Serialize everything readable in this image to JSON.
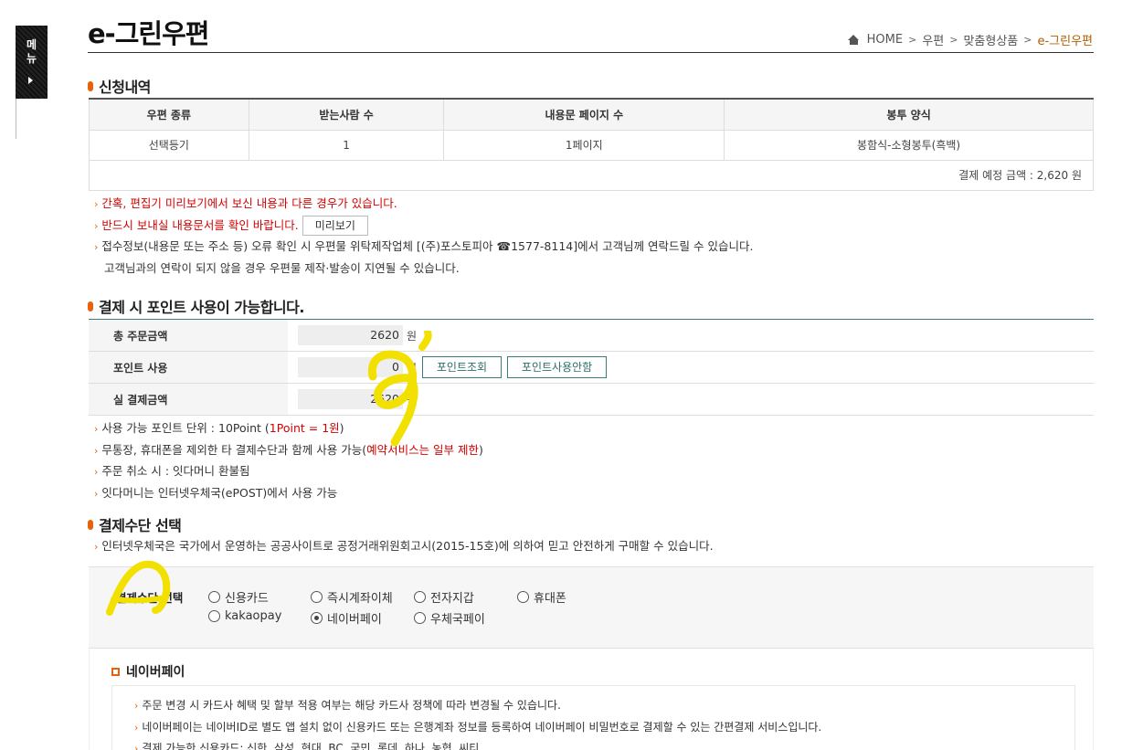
{
  "side_menu": {
    "label_line1": "메",
    "label_line2": "뉴"
  },
  "page": {
    "title": "e-그린우편"
  },
  "breadcrumb": {
    "home": "HOME",
    "level1": "우편",
    "level2": "맞춤형상품",
    "current": "e-그린우편"
  },
  "apply": {
    "heading": "신청내역",
    "headers": [
      "우편 종류",
      "받는사람 수",
      "내용문 페이지 수",
      "봉투 양식"
    ],
    "row": [
      "선택등기",
      "1",
      "1페이지",
      "봉함식-소형봉투(흑백)"
    ],
    "total_label": "결제 예정 금액 : 2,620 원"
  },
  "notes1": {
    "line1": "간혹, 편집기 미리보기에서 보신 내용과 다른 경우가 있습니다.",
    "line2": "반드시 보내실 내용문서를 확인 바랍니다.",
    "preview_button": "미리보기",
    "line3": "접수정보(내용문 또는 주소 등) 오류 확인 시 우편물 위탁제작업체 [(주)포스토피아 ☎1577-8114]에서 고객님께 연락드릴 수 있습니다.",
    "line4": "고객님과의 연락이 되지 않을 경우 우편물 제작·발송이 지연될 수 있습니다."
  },
  "points": {
    "heading": "결제 시 포인트 사용이 가능합니다.",
    "total_label": "총 주문금액",
    "total_value": "2620",
    "use_label": "포인트 사용",
    "use_value": "0",
    "final_label": "실 결제금액",
    "final_value": "2620",
    "currency": "원",
    "query_button": "포인트조회",
    "nouse_button": "포인트사용안함"
  },
  "notes2": {
    "line1_a": "사용 가능 포인트 단위 : 10Point (",
    "line1_red": "1Point = 1원",
    "line1_b": ")",
    "line2_a": "무통장, 휴대폰을 제외한 타 결제수단과 함께 사용 가능(",
    "line2_red": "예약서비스는 일부 제한",
    "line2_b": ")",
    "line3": "주문 취소 시 : 잇다머니 환불됨",
    "line4": "잇다머니는 인터넷우체국(ePOST)에서 사용 가능"
  },
  "payment": {
    "heading": "결제수단 선택",
    "note": "인터넷우체국은 국가에서 운영하는 공공사이트로 공정거래위원회고시(2015-15호)에 의하여 믿고 안전하게 구매할 수 있습니다.",
    "select_label": "결제수단 선택",
    "options": [
      "신용카드",
      "즉시계좌이체",
      "전자지갑",
      "휴대폰",
      "kakaopay",
      "네이버페이",
      "우체국페이"
    ],
    "selected": "네이버페이"
  },
  "naverpay": {
    "title": "네이버페이",
    "line1": "주문 변경 시 카드사 혜택 및 할부 적용 여부는 해당 카드사 정책에 따라 변경될 수 있습니다.",
    "line2": "네이버페이는 네이버ID로 별도 앱 설치 없이 신용카드 또는 은행계좌 정보를 등록하여 네이버페이 비밀번호로 결제할 수 있는 간편결제 서비스입니다.",
    "line3": "결제 가능한 신용카드: 신한, 삼성, 현대, BC, 국민, 롯데, 하나, 농협, 씨티"
  },
  "colors": {
    "accent": "#e8620c",
    "teal": "#3a7d7a",
    "highlight": "#f2e000",
    "red_text": "#d40000"
  }
}
